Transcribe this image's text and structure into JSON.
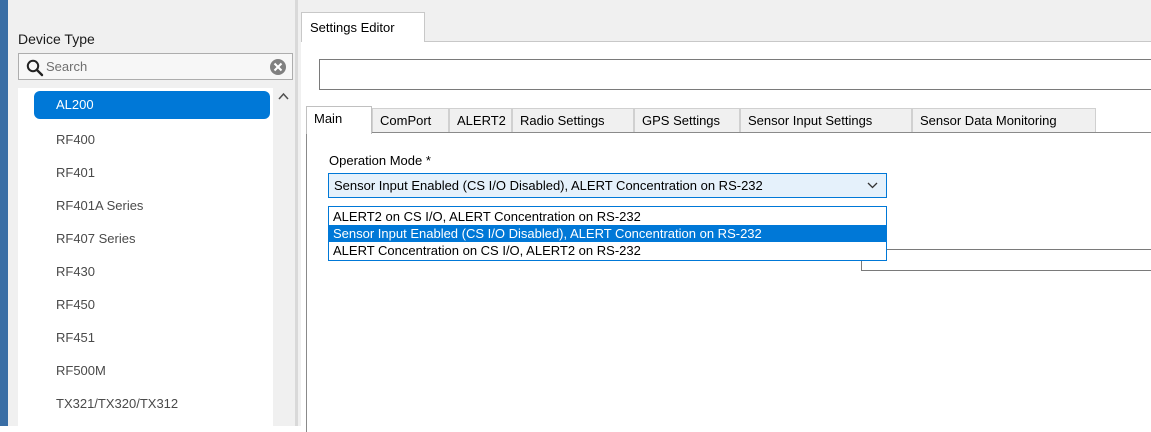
{
  "device_panel": {
    "title": "Device Type",
    "search": {
      "placeholder": "Search",
      "value": ""
    },
    "items": [
      {
        "label": "AL200",
        "selected": true
      },
      {
        "label": "RF400"
      },
      {
        "label": "RF401"
      },
      {
        "label": "RF401A Series"
      },
      {
        "label": "RF407 Series"
      },
      {
        "label": "RF430"
      },
      {
        "label": "RF450"
      },
      {
        "label": "RF451"
      },
      {
        "label": "RF500M"
      },
      {
        "label": "TX321/TX320/TX312"
      }
    ]
  },
  "editor": {
    "tab_label": "Settings Editor",
    "tabs": [
      {
        "label": "Main",
        "active": true
      },
      {
        "label": "ComPort"
      },
      {
        "label": "ALERT2"
      },
      {
        "label": "Radio Settings"
      },
      {
        "label": "GPS Settings"
      },
      {
        "label": "Sensor Input Settings"
      },
      {
        "label": "Sensor Data Monitoring"
      }
    ],
    "operation_mode": {
      "label": "Operation Mode  *",
      "value": "Sensor Input Enabled (CS I/O Disabled), ALERT Concentration on RS-232",
      "options": [
        "ALERT2 on CS I/O, ALERT Concentration on RS-232",
        "Sensor Input Enabled (CS I/O Disabled), ALERT Concentration on RS-232",
        "ALERT Concentration on CS I/O, ALERT2 on RS-232"
      ],
      "highlighted_option": 1
    }
  },
  "colors": {
    "accent": "#0078d7",
    "left_edge": "#3a6ea5"
  },
  "icons": [
    "search-icon",
    "clear-icon",
    "scroll-up-icon",
    "chevron-down-icon"
  ]
}
